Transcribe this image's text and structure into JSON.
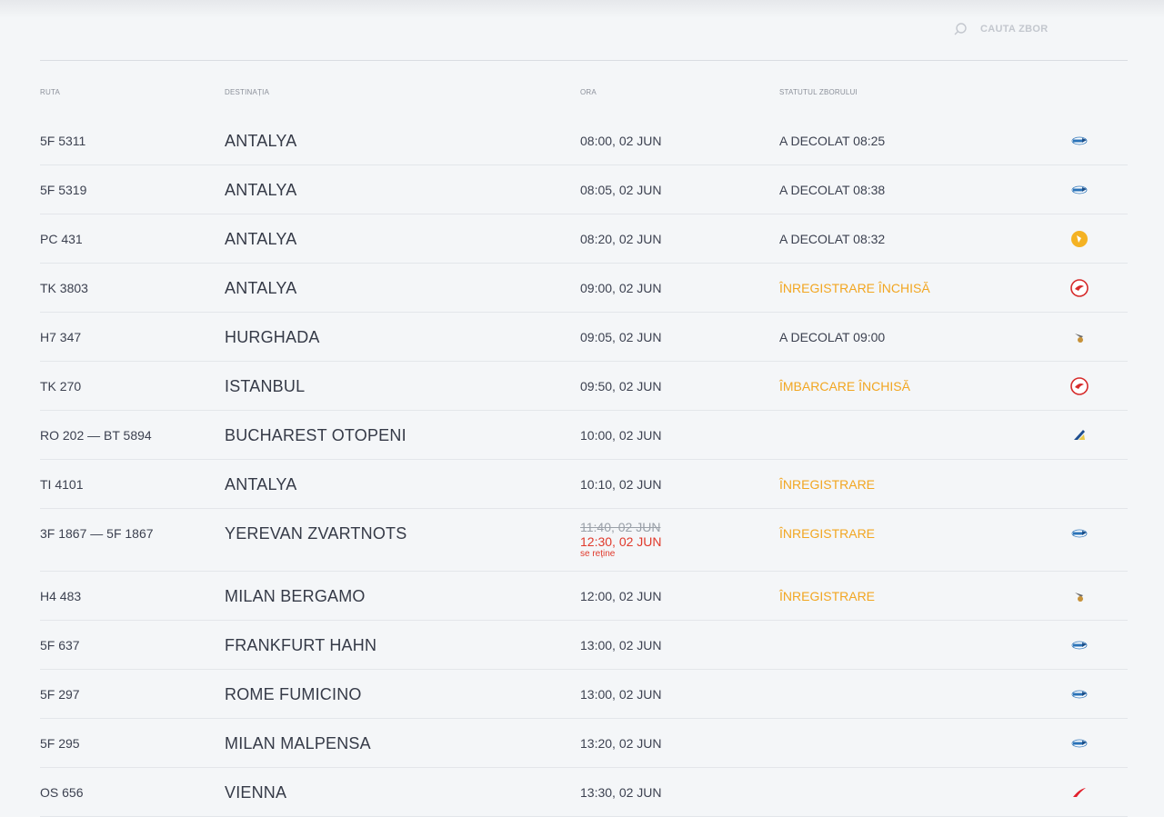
{
  "search": {
    "label": "CAUTA ZBOR"
  },
  "table": {
    "headers": [
      "RUTA",
      "DESTINAȚIA",
      "ORA",
      "STATUTUL ZBORULUI"
    ]
  },
  "flights": [
    {
      "route": "5F 5311",
      "destination": "ANTALYA",
      "time": "08:00, 02 JUN",
      "status": "A DECOLAT 08:25",
      "status_type": "normal",
      "airline_logo": "fly-one-logo"
    },
    {
      "route": "5F 5319",
      "destination": "ANTALYA",
      "time": "08:05, 02 JUN",
      "status": "A DECOLAT 08:38",
      "status_type": "normal",
      "airline_logo": "fly-one-logo"
    },
    {
      "route": "PC 431",
      "destination": "ANTALYA",
      "time": "08:20, 02 JUN",
      "status": "A DECOLAT 08:32",
      "status_type": "normal",
      "airline_logo": "pegasus-logo"
    },
    {
      "route": "TK 3803",
      "destination": "ANTALYA",
      "time": "09:00, 02 JUN",
      "status": "ÎNREGISTRARE ÎNCHISĂ",
      "status_type": "warn",
      "airline_logo": "turkish-airlines-logo"
    },
    {
      "route": "H7 347",
      "destination": "HURGHADA",
      "time": "09:05, 02 JUN",
      "status": "A DECOLAT 09:00",
      "status_type": "normal",
      "airline_logo": "hisky-logo"
    },
    {
      "route": "TK 270",
      "destination": "ISTANBUL",
      "time": "09:50, 02 JUN",
      "status": "ÎMBARCARE ÎNCHISĂ",
      "status_type": "warn",
      "airline_logo": "turkish-airlines-logo"
    },
    {
      "route": "RO 202 — BT 5894",
      "destination": "BUCHAREST OTOPENI",
      "time": "10:00, 02 JUN",
      "status": "",
      "status_type": "normal",
      "airline_logo": "tarom-logo"
    },
    {
      "route": "TI 4101",
      "destination": "ANTALYA",
      "time": "10:10, 02 JUN",
      "status": "ÎNREGISTRARE",
      "status_type": "warn",
      "airline_logo": ""
    },
    {
      "route": "3F 1867 — 5F 1867",
      "destination": "YEREVAN ZVARTNOTS",
      "time_old": "11:40, 02 JUN",
      "time": "12:30, 02 JUN",
      "time_note": "se reține",
      "status": "ÎNREGISTRARE",
      "status_type": "warn",
      "airline_logo": "fly-one-logo",
      "delayed": true
    },
    {
      "route": "H4 483",
      "destination": "MILAN BERGAMO",
      "time": "12:00, 02 JUN",
      "status": "ÎNREGISTRARE",
      "status_type": "warn",
      "airline_logo": "hisky-logo"
    },
    {
      "route": "5F 637",
      "destination": "FRANKFURT HAHN",
      "time": "13:00, 02 JUN",
      "status": "",
      "status_type": "normal",
      "airline_logo": "fly-one-logo"
    },
    {
      "route": "5F 297",
      "destination": "ROME FUMICINO",
      "time": "13:00, 02 JUN",
      "status": "",
      "status_type": "normal",
      "airline_logo": "fly-one-logo"
    },
    {
      "route": "5F 295",
      "destination": "MILAN MALPENSA",
      "time": "13:20, 02 JUN",
      "status": "",
      "status_type": "normal",
      "airline_logo": "fly-one-logo"
    },
    {
      "route": "OS 656",
      "destination": "VIENNA",
      "time": "13:30, 02 JUN",
      "status": "",
      "status_type": "normal",
      "airline_logo": "austrian-logo"
    }
  ]
}
